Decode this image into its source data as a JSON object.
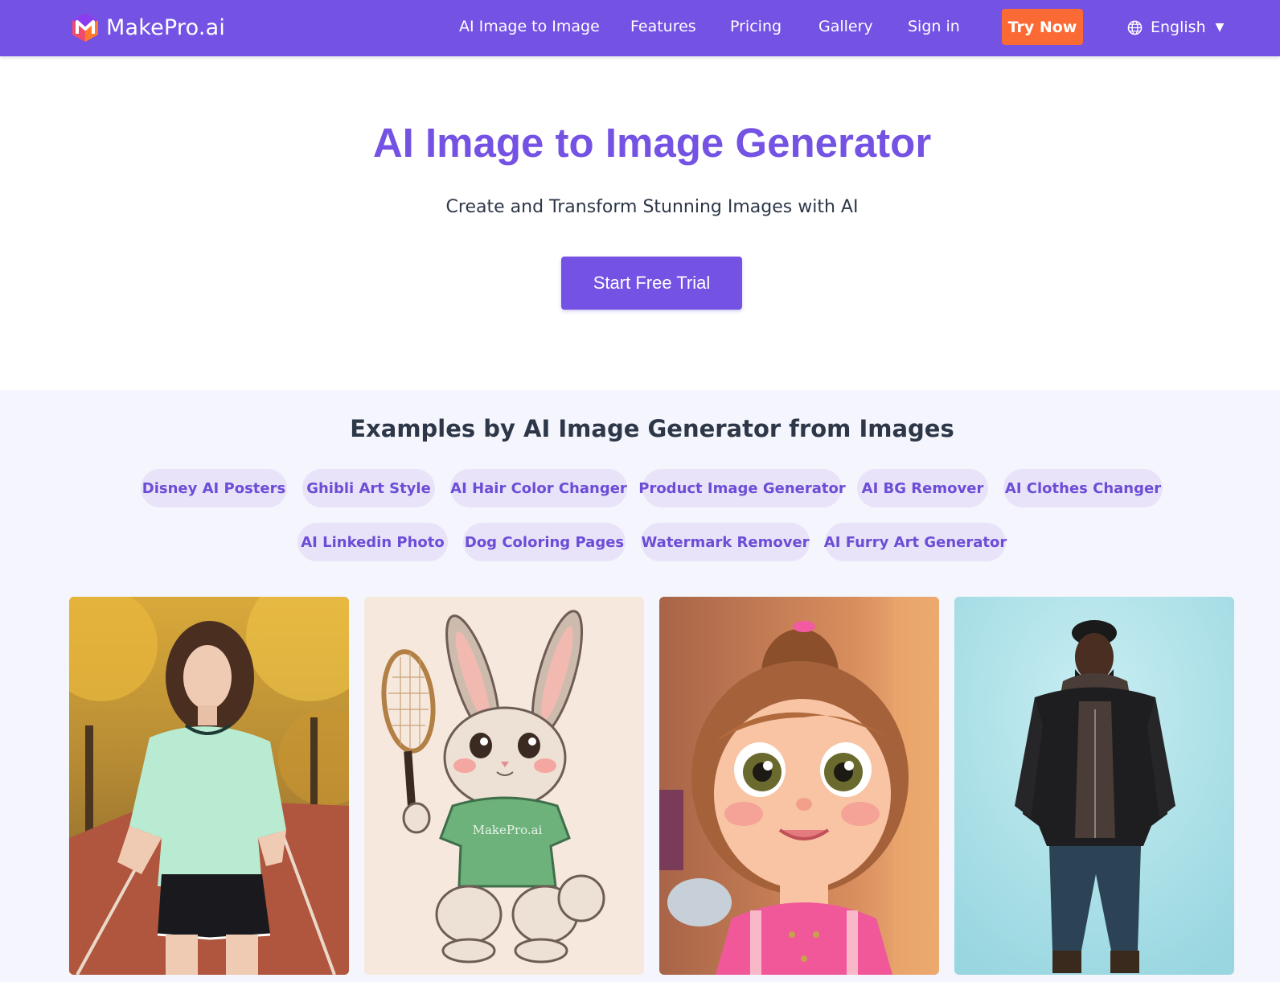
{
  "header": {
    "logo_text": "MakePro.ai",
    "nav": [
      "AI Image to Image",
      "Features",
      "Pricing",
      "Gallery",
      "Sign in"
    ],
    "try_now": "Try Now",
    "language": "English"
  },
  "hero": {
    "title": "AI Image to Image Generator",
    "subtitle": "Create and Transform Stunning Images with AI",
    "cta": "Start Free Trial"
  },
  "examples": {
    "title": "Examples by AI Image Generator from Images",
    "categories": [
      "Disney AI Posters",
      "Ghibli Art Style",
      "AI Hair Color Changer",
      "Product Image Generator",
      "AI BG Remover",
      "AI Clothes Changer",
      "AI Linkedin Photo",
      "Dog Coloring Pages",
      "Watermark Remover",
      "AI Furry Art Generator"
    ],
    "card_images": [
      {
        "name": "runner-woman-image",
        "bg": "#b07a2c"
      },
      {
        "name": "bunny-tennis-image",
        "bg": "#f7e8de",
        "shirt_text": "MakePro.ai"
      },
      {
        "name": "cartoon-girl-image",
        "bg": "#c47a53"
      },
      {
        "name": "man-leather-jacket-image",
        "bg": "#aee3ea"
      }
    ]
  },
  "colors": {
    "brand": "#7452e3",
    "accent": "#fb6a35",
    "chip_bg": "#e9e3fa",
    "section_bg": "#f4f5fd"
  }
}
